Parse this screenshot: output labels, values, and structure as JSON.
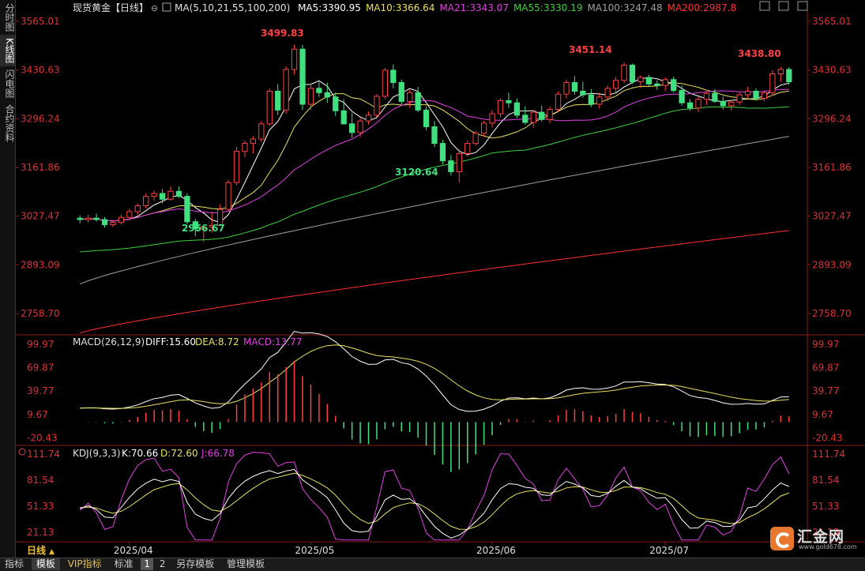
{
  "sidebar": {
    "tabs": [
      {
        "label": "分时图",
        "active": false
      },
      {
        "label": "K线图",
        "active": true
      },
      {
        "label": "闪电图",
        "active": false
      },
      {
        "label": "合约资料",
        "active": false
      }
    ]
  },
  "main_panel": {
    "title": "现货黄金【日线】",
    "ma_label": "MA(5,10,21,55,100,200)",
    "ma_items": [
      {
        "text": "MA5:3390.95",
        "color": "#ffffff"
      },
      {
        "text": "MA10:3366.64",
        "color": "#e8e060"
      },
      {
        "text": "MA21:3343.07",
        "color": "#e040e0"
      },
      {
        "text": "MA55:3330.19",
        "color": "#40d040"
      },
      {
        "text": "MA100:3247.48",
        "color": "#a0a0a0"
      },
      {
        "text": "MA200:2987.8",
        "color": "#ff3030"
      }
    ],
    "y_ticks": [
      "3565.01",
      "3430.63",
      "3296.24",
      "3161.86",
      "3027.47",
      "2893.09",
      "2758.70"
    ],
    "annotations": [
      {
        "text": "3499.83",
        "color": "#ff4040"
      },
      {
        "text": "3451.14",
        "color": "#ff4040"
      },
      {
        "text": "3438.80",
        "color": "#ff4040"
      },
      {
        "text": "3120.64",
        "color": "#40e080"
      },
      {
        "text": "2956.67",
        "color": "#40e080"
      }
    ]
  },
  "macd_panel": {
    "label": "MACD(26,12,9)",
    "diff": "DIFF:15.60",
    "dea": "DEA:8.72",
    "macd": "MACD:13.77",
    "y_ticks": [
      "99.97",
      "69.87",
      "39.77",
      "9.67",
      "-20.43"
    ]
  },
  "kdj_panel": {
    "label": "KDJ(9,3,3)",
    "k": "K:70.66",
    "d": "D:72.60",
    "j": "J:66.78",
    "y_ticks": [
      "111.74",
      "81.54",
      "51.33",
      "21.13"
    ]
  },
  "x_axis": {
    "period": "日线",
    "months": [
      "2025/04",
      "2025/05",
      "2025/06",
      "2025/07"
    ]
  },
  "bottom_bar": {
    "tabs": [
      {
        "label": "指标",
        "active": false
      },
      {
        "label": "模板",
        "active": true
      },
      {
        "label": "VIP指标",
        "active": false
      },
      {
        "label": "标准",
        "active": false
      },
      {
        "label": "1",
        "active": true
      },
      {
        "label": "2",
        "active": false
      },
      {
        "label": "另存模板",
        "active": false
      },
      {
        "label": "管理模板",
        "active": false
      }
    ]
  },
  "logo": {
    "name": "汇金网",
    "url": "www.gold678.com"
  },
  "colors": {
    "up": "#ff4040",
    "down": "#40e080",
    "grid": "#8b1a1a",
    "axis_text": "#e03030"
  },
  "chart_data": {
    "type": "candlestick",
    "title": "现货黄金【日线】",
    "ylim": [
      2700,
      3580
    ],
    "x": [
      "2025-03-24",
      "2025-03-25",
      "2025-03-26",
      "2025-03-27",
      "2025-03-28",
      "2025-03-31",
      "2025-04-01",
      "2025-04-02",
      "2025-04-03",
      "2025-04-04",
      "2025-04-07",
      "2025-04-08",
      "2025-04-09",
      "2025-04-10",
      "2025-04-11",
      "2025-04-14",
      "2025-04-15",
      "2025-04-16",
      "2025-04-17",
      "2025-04-18",
      "2025-04-21",
      "2025-04-22",
      "2025-04-23",
      "2025-04-24",
      "2025-04-25",
      "2025-04-28",
      "2025-04-29",
      "2025-04-30",
      "2025-05-01",
      "2025-05-02",
      "2025-05-05",
      "2025-05-06",
      "2025-05-07",
      "2025-05-08",
      "2025-05-09",
      "2025-05-12",
      "2025-05-13",
      "2025-05-14",
      "2025-05-15",
      "2025-05-16",
      "2025-05-19",
      "2025-05-20",
      "2025-05-21",
      "2025-05-22",
      "2025-05-23",
      "2025-05-26",
      "2025-05-27",
      "2025-05-28",
      "2025-05-29",
      "2025-05-30",
      "2025-06-02",
      "2025-06-03",
      "2025-06-04",
      "2025-06-05",
      "2025-06-06",
      "2025-06-09",
      "2025-06-10",
      "2025-06-11",
      "2025-06-12",
      "2025-06-13",
      "2025-06-16",
      "2025-06-17",
      "2025-06-18",
      "2025-06-19",
      "2025-06-20",
      "2025-06-23",
      "2025-06-24",
      "2025-06-25",
      "2025-06-26",
      "2025-06-27",
      "2025-06-30",
      "2025-07-01",
      "2025-07-02",
      "2025-07-03",
      "2025-07-04",
      "2025-07-07",
      "2025-07-08",
      "2025-07-09",
      "2025-07-10",
      "2025-07-11",
      "2025-07-14",
      "2025-07-15",
      "2025-07-16",
      "2025-07-17",
      "2025-07-18",
      "2025-07-21",
      "2025-07-22"
    ],
    "ohlc": [
      [
        3022,
        3030,
        3008,
        3018
      ],
      [
        3018,
        3032,
        3010,
        3022
      ],
      [
        3022,
        3034,
        3012,
        3018
      ],
      [
        3018,
        3025,
        2996,
        3004
      ],
      [
        3004,
        3014,
        2998,
        3010
      ],
      [
        3010,
        3032,
        3004,
        3024
      ],
      [
        3024,
        3048,
        3016,
        3040
      ],
      [
        3040,
        3062,
        3030,
        3056
      ],
      [
        3056,
        3090,
        3048,
        3082
      ],
      [
        3082,
        3098,
        3070,
        3090
      ],
      [
        3090,
        3102,
        3062,
        3074
      ],
      [
        3074,
        3110,
        3070,
        3096
      ],
      [
        3096,
        3110,
        3078,
        3082
      ],
      [
        3082,
        3090,
        3006,
        3012
      ],
      [
        3012,
        3020,
        2972,
        2992
      ],
      [
        2992,
        3004,
        2956,
        2998
      ],
      [
        2998,
        3040,
        2982,
        3002
      ],
      [
        3002,
        3060,
        3000,
        3046
      ],
      [
        3046,
        3128,
        3040,
        3120
      ],
      [
        3120,
        3218,
        3112,
        3206
      ],
      [
        3206,
        3236,
        3190,
        3228
      ],
      [
        3228,
        3248,
        3200,
        3240
      ],
      [
        3240,
        3290,
        3232,
        3282
      ],
      [
        3282,
        3380,
        3276,
        3372
      ],
      [
        3372,
        3392,
        3306,
        3320
      ],
      [
        3320,
        3440,
        3310,
        3432
      ],
      [
        3432,
        3500,
        3418,
        3488
      ],
      [
        3488,
        3500,
        3320,
        3336
      ],
      [
        3336,
        3392,
        3320,
        3380
      ],
      [
        3380,
        3398,
        3356,
        3368
      ],
      [
        3368,
        3396,
        3340,
        3356
      ],
      [
        3356,
        3368,
        3304,
        3318
      ],
      [
        3318,
        3350,
        3280,
        3282
      ],
      [
        3282,
        3312,
        3244,
        3258
      ],
      [
        3258,
        3298,
        3246,
        3290
      ],
      [
        3290,
        3316,
        3280,
        3306
      ],
      [
        3306,
        3364,
        3300,
        3358
      ],
      [
        3358,
        3436,
        3350,
        3430
      ],
      [
        3430,
        3446,
        3380,
        3396
      ],
      [
        3396,
        3404,
        3336,
        3344
      ],
      [
        3344,
        3376,
        3326,
        3368
      ],
      [
        3368,
        3384,
        3314,
        3320
      ],
      [
        3320,
        3330,
        3264,
        3274
      ],
      [
        3274,
        3290,
        3218,
        3228
      ],
      [
        3228,
        3238,
        3170,
        3180
      ],
      [
        3180,
        3196,
        3140,
        3150
      ],
      [
        3150,
        3212,
        3120,
        3200
      ],
      [
        3200,
        3236,
        3192,
        3228
      ],
      [
        3228,
        3262,
        3222,
        3256
      ],
      [
        3256,
        3290,
        3246,
        3284
      ],
      [
        3284,
        3320,
        3272,
        3310
      ],
      [
        3310,
        3352,
        3300,
        3346
      ],
      [
        3346,
        3368,
        3326,
        3340
      ],
      [
        3340,
        3352,
        3298,
        3306
      ],
      [
        3306,
        3330,
        3280,
        3286
      ],
      [
        3286,
        3320,
        3270,
        3314
      ],
      [
        3314,
        3332,
        3288,
        3294
      ],
      [
        3294,
        3330,
        3284,
        3322
      ],
      [
        3322,
        3372,
        3316,
        3364
      ],
      [
        3364,
        3404,
        3352,
        3396
      ],
      [
        3396,
        3414,
        3362,
        3372
      ],
      [
        3372,
        3398,
        3354,
        3362
      ],
      [
        3362,
        3378,
        3328,
        3336
      ],
      [
        3336,
        3368,
        3324,
        3356
      ],
      [
        3356,
        3388,
        3344,
        3380
      ],
      [
        3380,
        3412,
        3368,
        3402
      ],
      [
        3402,
        3451,
        3394,
        3444
      ],
      [
        3444,
        3448,
        3392,
        3398
      ],
      [
        3398,
        3416,
        3380,
        3410
      ],
      [
        3410,
        3418,
        3386,
        3392
      ],
      [
        3392,
        3402,
        3376,
        3388
      ],
      [
        3388,
        3410,
        3372,
        3404
      ],
      [
        3404,
        3412,
        3368,
        3374
      ],
      [
        3374,
        3388,
        3332,
        3340
      ],
      [
        3340,
        3350,
        3318,
        3326
      ],
      [
        3326,
        3356,
        3314,
        3350
      ],
      [
        3350,
        3372,
        3334,
        3366
      ],
      [
        3366,
        3378,
        3340,
        3344
      ],
      [
        3344,
        3358,
        3322,
        3332
      ],
      [
        3332,
        3348,
        3318,
        3342
      ],
      [
        3342,
        3368,
        3334,
        3362
      ],
      [
        3362,
        3384,
        3352,
        3372
      ],
      [
        3372,
        3380,
        3346,
        3352
      ],
      [
        3352,
        3374,
        3344,
        3368
      ],
      [
        3368,
        3430,
        3360,
        3420
      ],
      [
        3420,
        3439,
        3398,
        3432
      ],
      [
        3432,
        3438,
        3390,
        3398
      ]
    ],
    "macd": {
      "diff_last": 15.6,
      "dea_last": 8.72,
      "macd_last": 13.77,
      "ylim": [
        -30,
        110
      ]
    },
    "kdj": {
      "k_last": 70.66,
      "d_last": 72.6,
      "j_last": 66.78,
      "ylim": [
        10,
        120
      ]
    }
  }
}
